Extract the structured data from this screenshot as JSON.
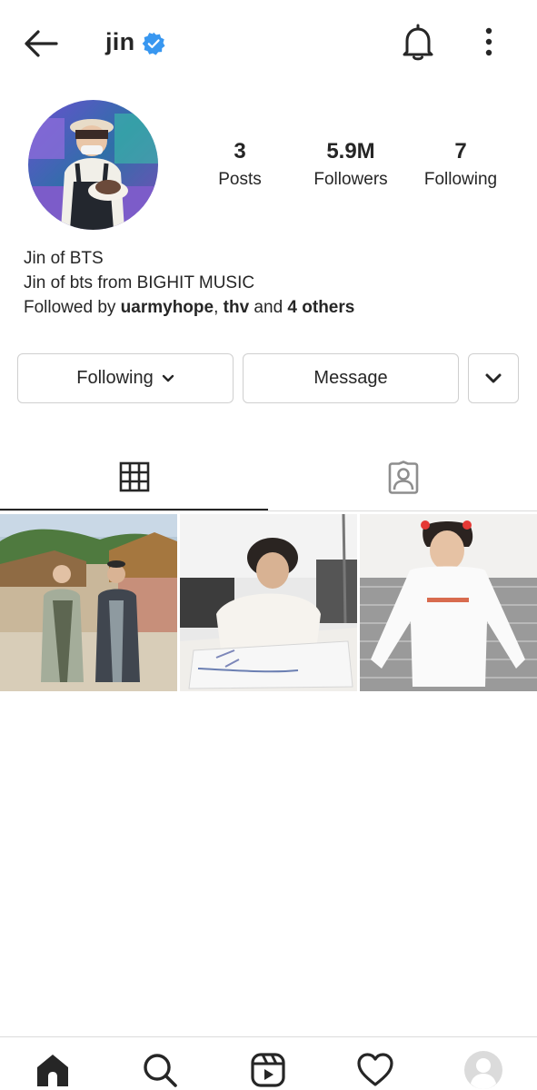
{
  "header": {
    "username": "jin",
    "verified": true,
    "accent_color": "#3897f0",
    "icons": [
      "back-arrow-icon",
      "verified-badge-icon",
      "bell-icon",
      "more-vertical-icon"
    ]
  },
  "profile": {
    "stats": [
      {
        "value": "3",
        "label": "Posts"
      },
      {
        "value": "5.9M",
        "label": "Followers"
      },
      {
        "value": "7",
        "label": "Following"
      }
    ],
    "bio": {
      "name": "Jin of BTS",
      "description": "Jin of bts from BIGHIT MUSIC",
      "followed_by_prefix": "Followed by ",
      "followed_by_user1": "uarmyhope",
      "followed_by_sep": ", ",
      "followed_by_user2": "thv",
      "followed_by_and": " and ",
      "followed_by_others": "4 others"
    }
  },
  "actions": {
    "following_label": "Following",
    "message_label": "Message"
  },
  "tabs": [
    {
      "name": "grid",
      "icon": "grid-icon",
      "active": true
    },
    {
      "name": "tagged",
      "icon": "tagged-person-icon",
      "active": false
    }
  ],
  "posts": [
    {
      "icon": "photo-two-men-hanbok"
    },
    {
      "icon": "photo-man-writing-bag"
    },
    {
      "icon": "photo-man-white-shirt"
    }
  ],
  "bottom_nav": [
    {
      "name": "home",
      "icon": "home-icon",
      "active": true
    },
    {
      "name": "search",
      "icon": "search-icon"
    },
    {
      "name": "reels",
      "icon": "reels-icon"
    },
    {
      "name": "activity",
      "icon": "heart-icon"
    },
    {
      "name": "profile",
      "icon": "profile-avatar-icon"
    }
  ]
}
